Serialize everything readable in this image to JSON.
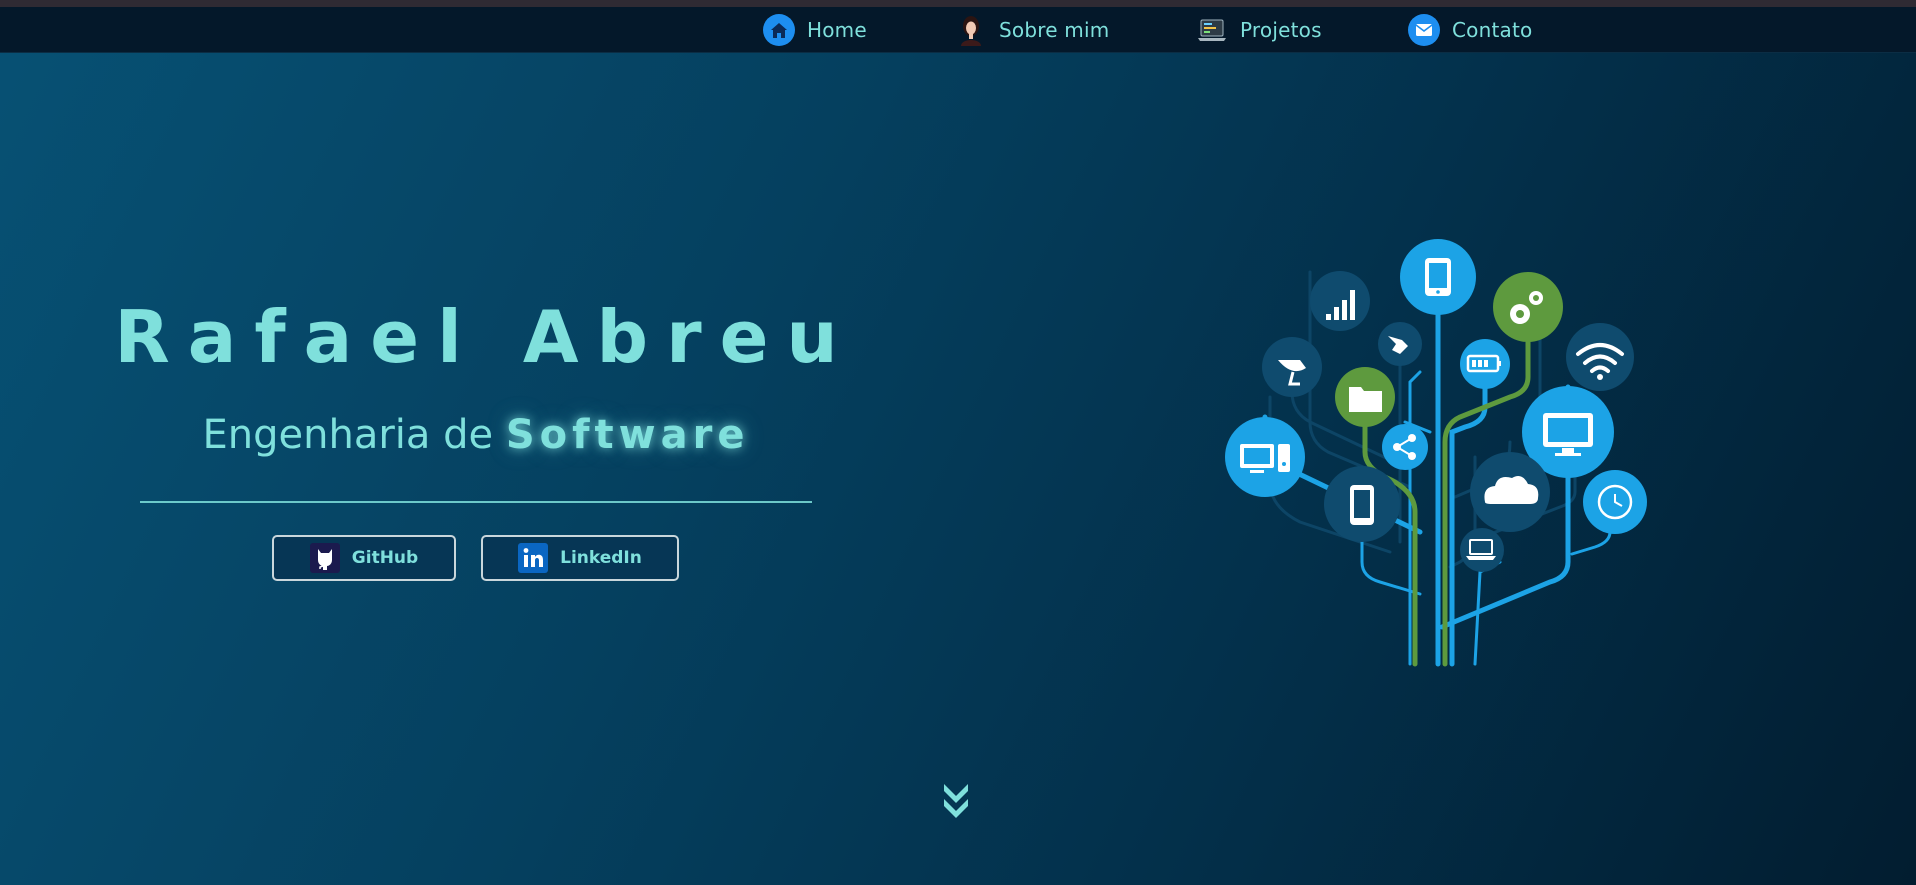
{
  "nav": {
    "items": [
      {
        "label": "Home",
        "icon": "home-icon"
      },
      {
        "label": "Sobre mim",
        "icon": "avatar-icon"
      },
      {
        "label": "Projetos",
        "icon": "laptop-code-icon"
      },
      {
        "label": "Contato",
        "icon": "mail-icon"
      }
    ]
  },
  "hero": {
    "name": "Rafael Abreu",
    "subtitle_prefix": "Engenharia de",
    "subtitle_highlight": "Software"
  },
  "social": {
    "github_label": "GitHub",
    "linkedin_label": "LinkedIn"
  },
  "colors": {
    "accent": "#7fe0dc",
    "navbar": "#04182a",
    "tree_blue": "#1ca3e6",
    "tree_green": "#5e9a3e",
    "tree_dark": "#0d4566"
  },
  "illustration": "technology-tree-icon",
  "scroll_indicator": "chevron-double-down-icon"
}
